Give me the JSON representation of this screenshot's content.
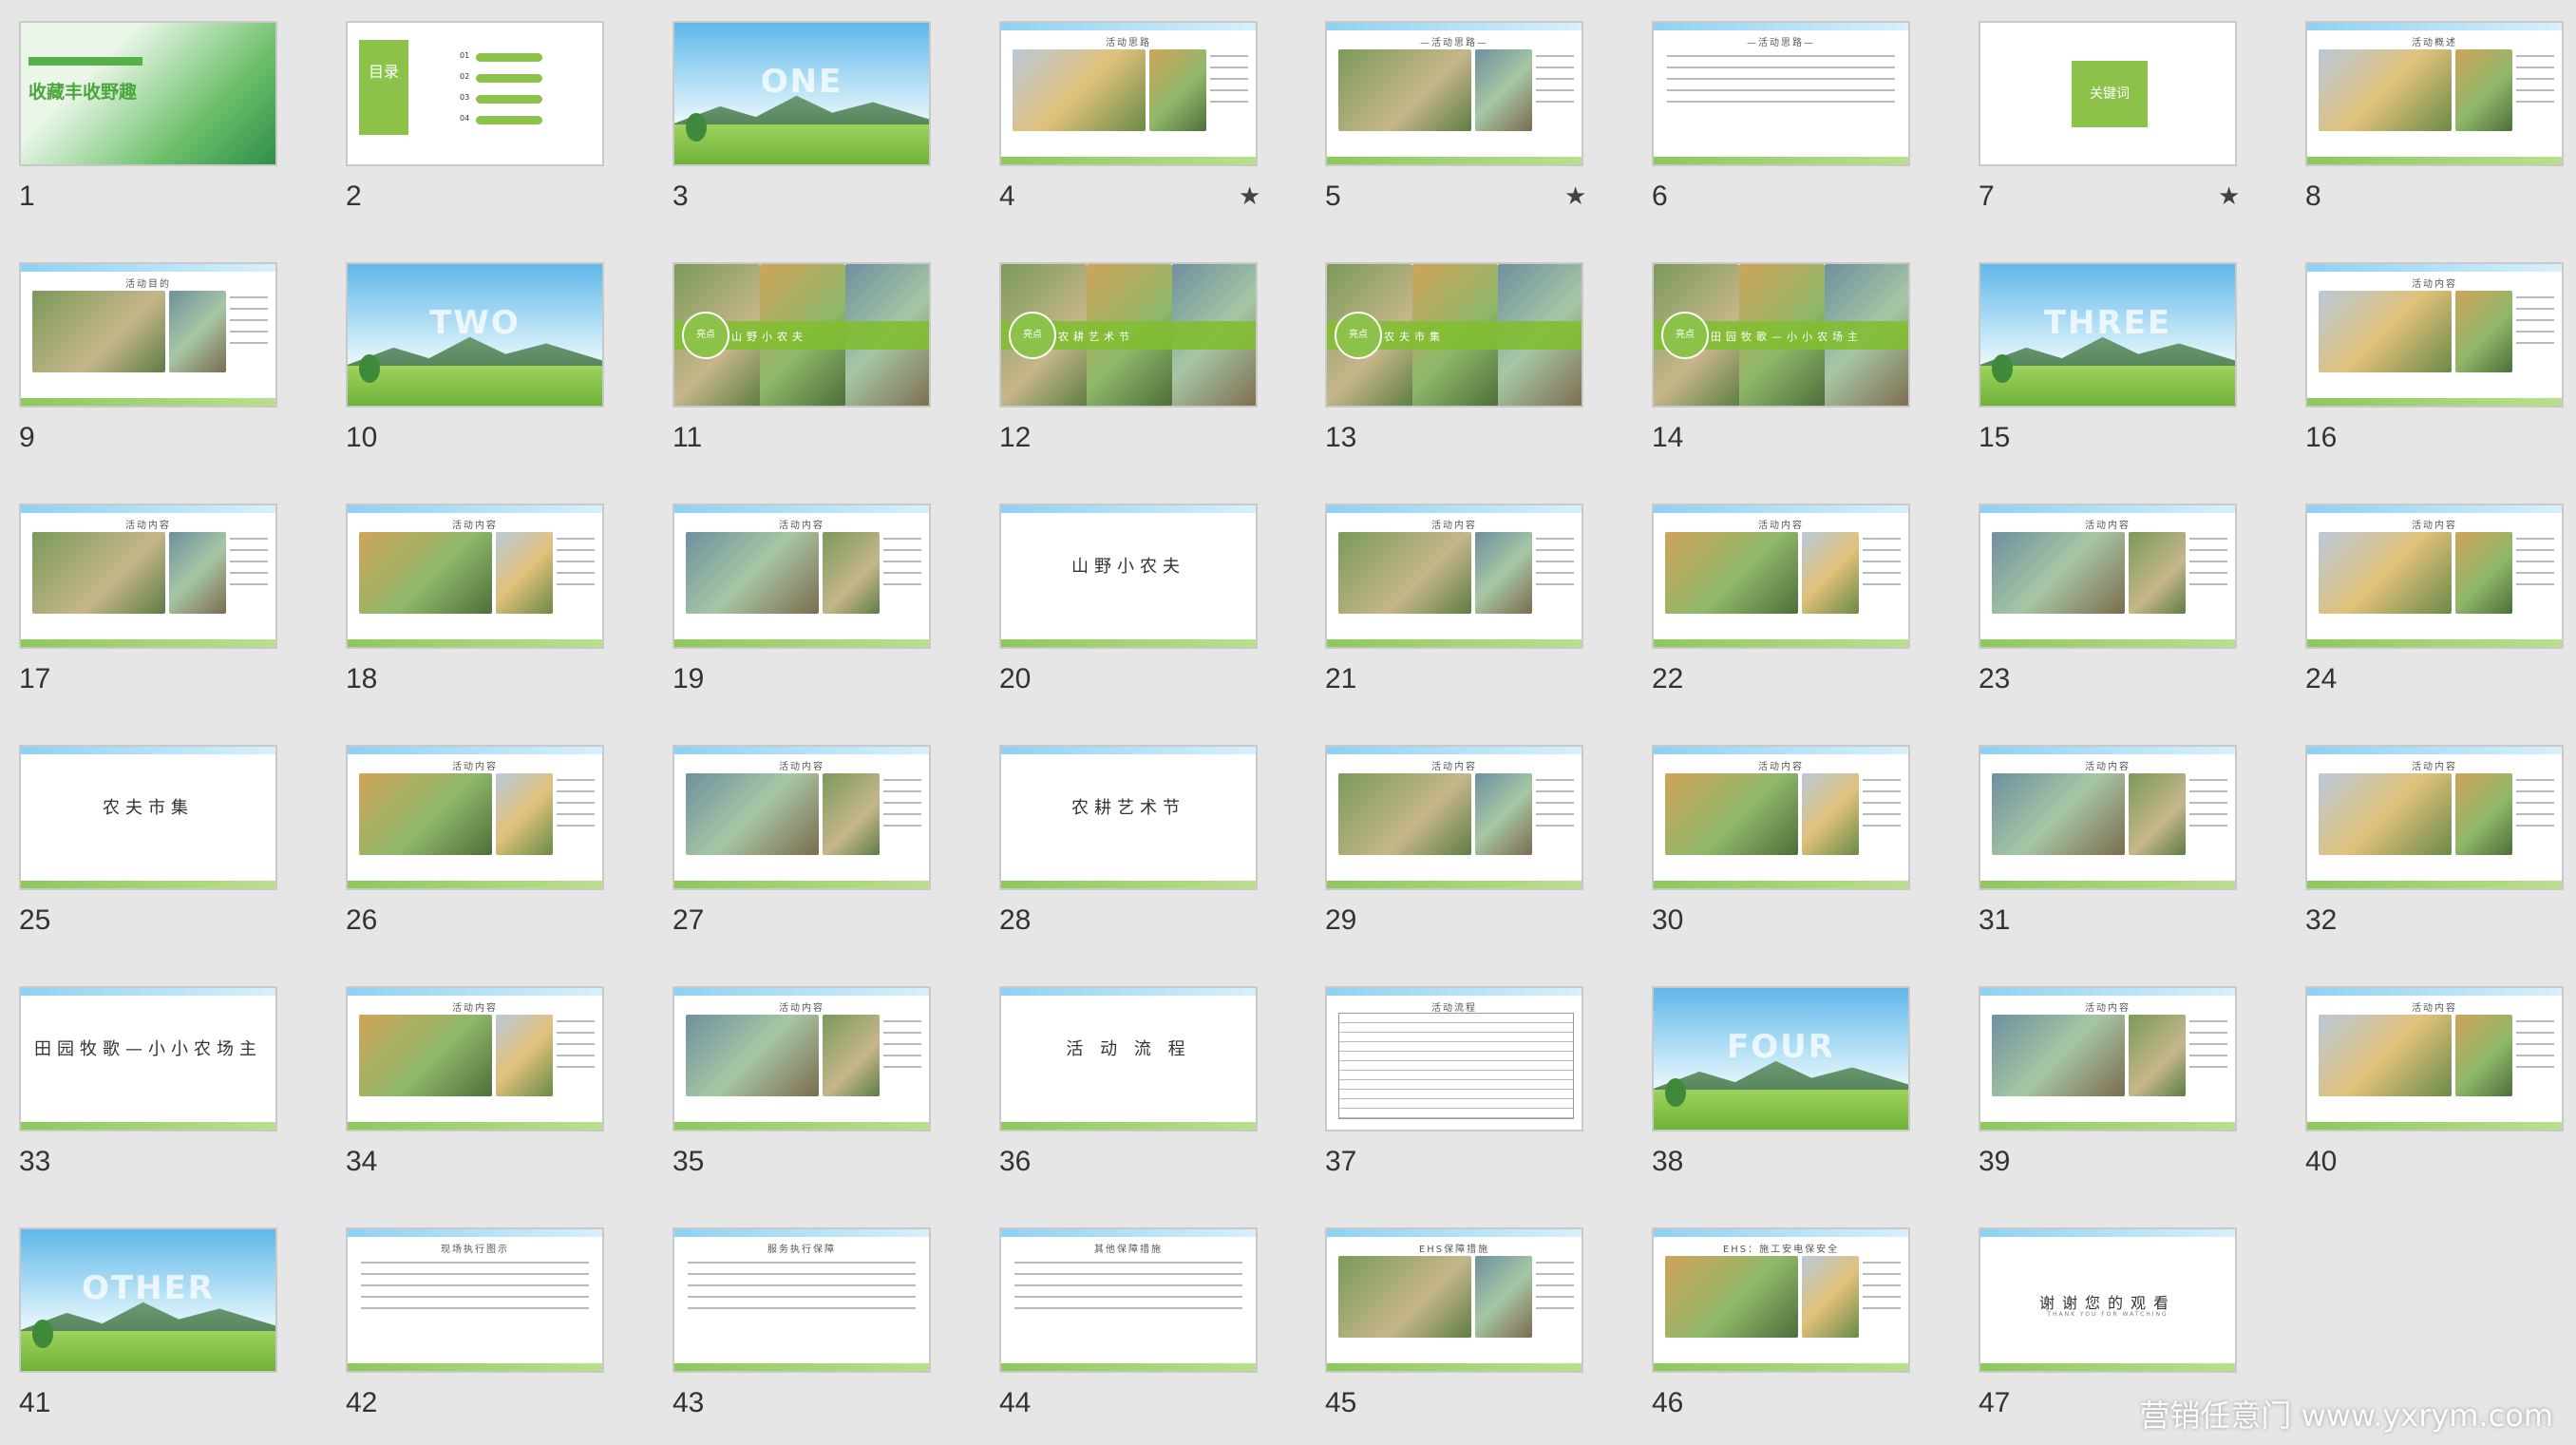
{
  "slides": [
    {
      "n": "1",
      "type": "cover",
      "title": "收藏丰收野趣",
      "star": ""
    },
    {
      "n": "2",
      "type": "toc",
      "title": "目录",
      "star": ""
    },
    {
      "n": "3",
      "type": "section",
      "title": "ONE",
      "star": ""
    },
    {
      "n": "4",
      "type": "content",
      "title": "活动思路",
      "star": "★"
    },
    {
      "n": "5",
      "type": "content",
      "title": "—活动思路—",
      "star": "★"
    },
    {
      "n": "6",
      "type": "text",
      "title": "—活动思路—",
      "star": ""
    },
    {
      "n": "7",
      "type": "keyword",
      "title": "关键词",
      "star": "★"
    },
    {
      "n": "8",
      "type": "content",
      "title": "活动概述",
      "star": ""
    },
    {
      "n": "9",
      "type": "content",
      "title": "活动目的",
      "star": ""
    },
    {
      "n": "10",
      "type": "section",
      "title": "TWO",
      "star": ""
    },
    {
      "n": "11",
      "type": "highlight",
      "title": "山野小农夫",
      "star": ""
    },
    {
      "n": "12",
      "type": "highlight",
      "title": "农耕艺术节",
      "star": ""
    },
    {
      "n": "13",
      "type": "highlight",
      "title": "农夫市集",
      "star": ""
    },
    {
      "n": "14",
      "type": "highlight",
      "title": "田园牧歌—小小农场主",
      "star": ""
    },
    {
      "n": "15",
      "type": "section",
      "title": "THREE",
      "star": ""
    },
    {
      "n": "16",
      "type": "content",
      "title": "活动内容",
      "star": ""
    },
    {
      "n": "17",
      "type": "photos",
      "title": "活动内容",
      "star": ""
    },
    {
      "n": "18",
      "type": "photos",
      "title": "活动内容",
      "star": ""
    },
    {
      "n": "19",
      "type": "photos",
      "title": "活动内容",
      "star": ""
    },
    {
      "n": "20",
      "type": "titlecard",
      "title": "山野小农夫",
      "star": ""
    },
    {
      "n": "21",
      "type": "photos",
      "title": "活动内容",
      "star": ""
    },
    {
      "n": "22",
      "type": "photos",
      "title": "活动内容",
      "star": ""
    },
    {
      "n": "23",
      "type": "photos",
      "title": "活动内容",
      "star": ""
    },
    {
      "n": "24",
      "type": "photos",
      "title": "活动内容",
      "star": ""
    },
    {
      "n": "25",
      "type": "titlecard",
      "title": "农夫市集",
      "star": ""
    },
    {
      "n": "26",
      "type": "photos",
      "title": "活动内容",
      "star": ""
    },
    {
      "n": "27",
      "type": "photos",
      "title": "活动内容",
      "star": ""
    },
    {
      "n": "28",
      "type": "titlecard",
      "title": "农耕艺术节",
      "star": ""
    },
    {
      "n": "29",
      "type": "photos",
      "title": "活动内容",
      "star": ""
    },
    {
      "n": "30",
      "type": "photos",
      "title": "活动内容",
      "star": ""
    },
    {
      "n": "31",
      "type": "photos",
      "title": "活动内容",
      "star": ""
    },
    {
      "n": "32",
      "type": "photos",
      "title": "活动内容",
      "star": ""
    },
    {
      "n": "33",
      "type": "titlecard",
      "title": "田园牧歌—小小农场主",
      "star": ""
    },
    {
      "n": "34",
      "type": "photos",
      "title": "活动内容",
      "star": ""
    },
    {
      "n": "35",
      "type": "photos",
      "title": "活动内容",
      "star": ""
    },
    {
      "n": "36",
      "type": "titlecard",
      "title": "活 动 流 程",
      "star": ""
    },
    {
      "n": "37",
      "type": "table",
      "title": "活动流程",
      "star": ""
    },
    {
      "n": "38",
      "type": "section",
      "title": "FOUR",
      "star": ""
    },
    {
      "n": "39",
      "type": "photos",
      "title": "活动内容",
      "star": ""
    },
    {
      "n": "40",
      "type": "photos",
      "title": "活动内容",
      "star": ""
    },
    {
      "n": "41",
      "type": "section",
      "title": "OTHER",
      "star": ""
    },
    {
      "n": "42",
      "type": "text",
      "title": "现场执行图示",
      "star": ""
    },
    {
      "n": "43",
      "type": "text",
      "title": "服务执行保障",
      "star": ""
    },
    {
      "n": "44",
      "type": "text",
      "title": "其他保障措施",
      "star": ""
    },
    {
      "n": "45",
      "type": "photos",
      "title": "EHS保障措施",
      "star": ""
    },
    {
      "n": "46",
      "type": "photos",
      "title": "EHS：施工安电保安全",
      "star": ""
    },
    {
      "n": "47",
      "type": "thanks",
      "title": "谢谢您的观看",
      "subtitle": "THANK YOU FOR WATCHING",
      "star": ""
    }
  ],
  "watermark": "营销任意门 www.yxrym.com",
  "colors": {
    "background": "#e6e6e6",
    "accent_green": "#8cc24a",
    "sky_blue": "#5fb7ea"
  }
}
